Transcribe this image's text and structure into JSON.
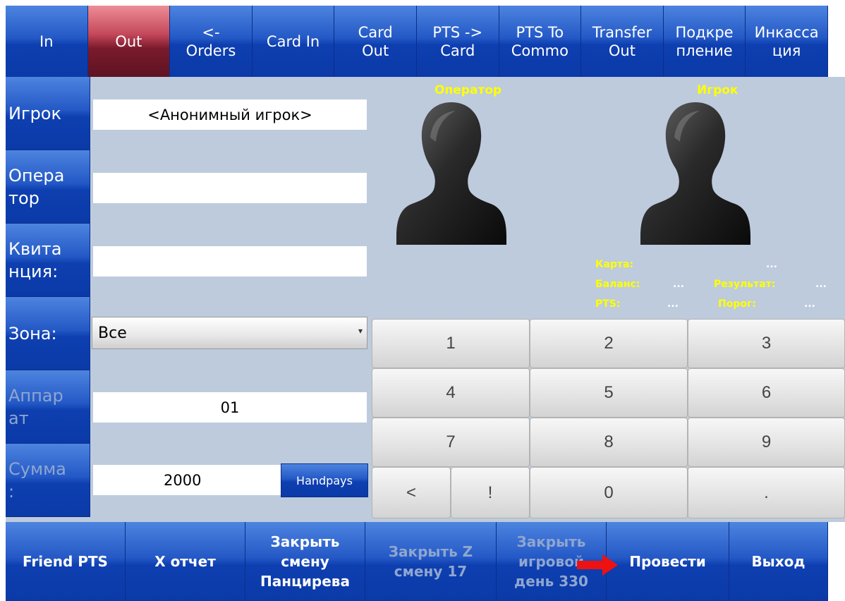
{
  "top_tabs": [
    {
      "label": "In",
      "active": false
    },
    {
      "label": "Out",
      "active": true
    },
    {
      "label": "<-\nOrders",
      "active": false
    },
    {
      "label": "Card In",
      "active": false
    },
    {
      "label": "Card\nOut",
      "active": false
    },
    {
      "label": "PTS ->\nCard",
      "active": false
    },
    {
      "label": "PTS To\nCommo",
      "active": false
    },
    {
      "label": "Transfer\nOut",
      "active": false
    },
    {
      "label": "Подкре\nпление",
      "active": false
    },
    {
      "label": "Инкасса\nция",
      "active": false
    }
  ],
  "side": {
    "player_label": "Игрок",
    "operator_label": "Опера\nтор",
    "receipt_label": "Квита\nнция:",
    "zone_label": "Зона:",
    "machine_label": "Аппар\nат",
    "amount_label": "Сумма\n:"
  },
  "fields": {
    "player_value": "<Анонимный игрок>",
    "operator_value": "",
    "receipt_value": "",
    "zone_selected": "Все",
    "machine_value": "01",
    "amount_value": "2000"
  },
  "handpays_label": "Handpays",
  "avatars": {
    "operator_label": "Оператор",
    "player_label": "Игрок"
  },
  "player_info": {
    "card_label": "Карта:",
    "card_value": "...",
    "balance_label": "Баланс:",
    "balance_value": "...",
    "result_label": "Результат:",
    "result_value": "...",
    "pts_label": "PTS:",
    "pts_value": "...",
    "threshold_label": "Порог:",
    "threshold_value": "..."
  },
  "keypad": {
    "k1": "1",
    "k2": "2",
    "k3": "3",
    "k4": "4",
    "k5": "5",
    "k6": "6",
    "k7": "7",
    "k8": "8",
    "k9": "9",
    "back": "<",
    "bang": "!",
    "k0": "0",
    "dot": "."
  },
  "bottom": {
    "friend_pts": "Friend PTS",
    "x_report": "X отчет",
    "close_shift": "Закрыть\nсмену\nПанцирева",
    "close_z": "Закрыть Z\nсмену 17",
    "close_day": "Закрыть\nигровой\nдень 330",
    "submit": "Провести",
    "exit": "Выход"
  },
  "colors": {
    "tab_blue": "#1f4fbf",
    "tab_active": "#8e2436",
    "panel_bg": "#bdcbdd",
    "info_yellow": "#ffff00",
    "arrow_red": "#ee1111"
  }
}
